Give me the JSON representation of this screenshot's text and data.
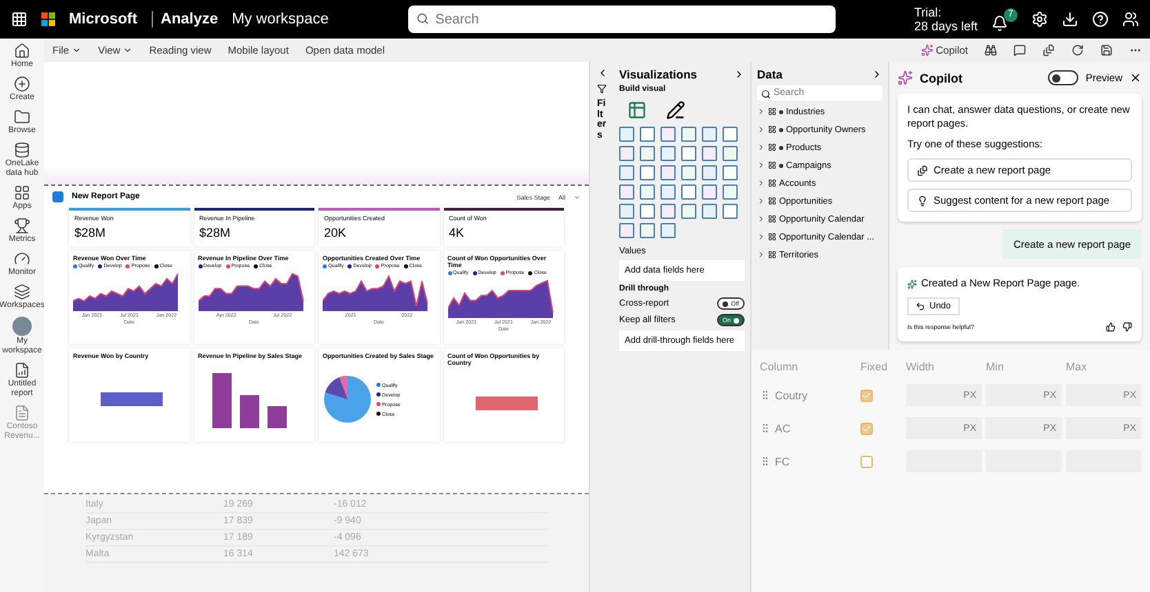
{
  "topbar": {
    "brand": "Microsoft",
    "app": "Analyze",
    "workspace": "My workspace",
    "search": {
      "placeholder": "Search"
    },
    "trial": [
      "Trial:",
      "28 days left"
    ],
    "notification_count": "7"
  },
  "nav": [
    {
      "label": "Home",
      "disabled": false
    },
    {
      "label": "Create",
      "disabled": false
    },
    {
      "label": "Browse",
      "disabled": false
    },
    {
      "label": "OneLake data hub",
      "disabled": false
    },
    {
      "label": "Apps",
      "disabled": false
    },
    {
      "label": "Metrics",
      "disabled": false
    },
    {
      "label": "Monitor",
      "disabled": false
    },
    {
      "label": "Workspaces",
      "disabled": false
    },
    {
      "label": "My workspace",
      "disabled": false
    },
    {
      "label": "Untitled report",
      "disabled": false
    },
    {
      "label": "Contoso Revenu...",
      "disabled": true
    }
  ],
  "toolbar": {
    "menus": [
      {
        "label": "File",
        "dropdown": true
      },
      {
        "label": "View",
        "dropdown": true
      },
      {
        "label": "Reading view",
        "dropdown": false
      },
      {
        "label": "Mobile layout",
        "dropdown": false
      },
      {
        "label": "Open data model",
        "dropdown": false
      }
    ],
    "copilot": "Copilot"
  },
  "report": {
    "title": "New Report Page",
    "slicer": {
      "label": "Sales Stage",
      "value": "All"
    },
    "kpis": [
      {
        "label": "Revenue Won",
        "value": "$28M",
        "color": "#3aa0d8"
      },
      {
        "label": "Revenue In Pipeline",
        "value": "$28M",
        "color": "#1b2a6b"
      },
      {
        "label": "Opportunities Created",
        "value": "20K",
        "color": "#b45fb0"
      },
      {
        "label": "Count of Won",
        "value": "4K",
        "color": "#4a1a4a"
      }
    ],
    "trend_charts": [
      {
        "title": "Revenue Won Over Time",
        "legend": [
          "Qualify",
          "Develop",
          "Propose",
          "Close"
        ],
        "axis": [
          "Jan 2021",
          "Jul 2021",
          "Jan 2022"
        ],
        "xlabel": "Date"
      },
      {
        "title": "Revenue In Pipeline Over Time",
        "legend": [
          "Develop",
          "Propose",
          "Close"
        ],
        "axis": [
          "Apr 2022",
          "Jul 2022"
        ],
        "xlabel": "Date"
      },
      {
        "title": "Opportunities Created Over Time",
        "legend": [
          "Qualify",
          "Develop",
          "Propose",
          "Close"
        ],
        "axis": [
          "2021",
          "2022"
        ],
        "xlabel": "Date"
      },
      {
        "title": "Count of Won Opportunities Over Time",
        "legend": [
          "Qualify",
          "Develop",
          "Propose",
          "Close"
        ],
        "axis": [
          "Jan 2021",
          "Jul 2021",
          "Jan 2022"
        ],
        "xlabel": "Date"
      }
    ],
    "bottom_charts": [
      {
        "title": "Revenue Won by Country",
        "kind": "hbar",
        "color": "#5b5fc7"
      },
      {
        "title": "Revenue In Pipeline by Sales Stage",
        "kind": "vbar",
        "color": "#8e3d9a"
      },
      {
        "title": "Opportunities Created by Sales Stage",
        "kind": "pie",
        "legend": [
          "Qualify",
          "Develop",
          "Propose",
          "Close"
        ]
      },
      {
        "title": "Count of Won Opportunities by Country",
        "kind": "hbar",
        "color": "#e06670"
      }
    ]
  },
  "country_table": [
    [
      "Italy",
      "19 269",
      "-16 012"
    ],
    [
      "Japan",
      "17 839",
      "-9 940"
    ],
    [
      "Kyrgyzstan",
      "17 189",
      "-4 096"
    ],
    [
      "Malta",
      "16 314",
      "142 673"
    ]
  ],
  "filters": {
    "label": "Filters"
  },
  "visualizations": {
    "title": "Visualizations",
    "subtitle": "Build visual",
    "values_label": "Values",
    "values_placeholder": "Add data fields here",
    "drill_title": "Drill through",
    "toggles": [
      {
        "label": "Cross-report",
        "on": false,
        "text": "Off"
      },
      {
        "label": "Keep all filters",
        "on": true,
        "text": "On"
      }
    ],
    "drill_placeholder": "Add drill-through fields here"
  },
  "data": {
    "title": "Data",
    "search": {
      "placeholder": "Search"
    },
    "items": [
      {
        "label": "Industries",
        "starred": true
      },
      {
        "label": "Opportunity Owners",
        "starred": true
      },
      {
        "label": "Products",
        "starred": true
      },
      {
        "label": "Campaigns",
        "starred": true
      },
      {
        "label": "Accounts",
        "starred": false
      },
      {
        "label": "Opportunities",
        "starred": false
      },
      {
        "label": "Opportunity Calendar",
        "starred": false
      },
      {
        "label": "Opportunity Calendar ...",
        "starred": false
      },
      {
        "label": "Territories",
        "starred": false
      }
    ]
  },
  "copilot": {
    "title": "Copilot",
    "preview_on": false,
    "preview_label": "Preview",
    "intro": "I can chat, answer data questions, or create new report pages.",
    "suggest_title": "Try one of these suggestions:",
    "suggestions": [
      {
        "label": "Create a new report page",
        "kind": "page"
      },
      {
        "label": "Suggest content for a new report page",
        "kind": "idea"
      }
    ],
    "user_message": "Create a new report page",
    "response": "Created a New Report Page page.",
    "undo": "Undo",
    "feedback": "Is this response helpful?"
  },
  "column_table": {
    "columns": [
      "Column",
      "Fixed",
      "Width",
      "Min",
      "Max"
    ],
    "rows": [
      {
        "name": "Coutry",
        "fixed": true,
        "width": "PX",
        "min": "PX",
        "max": "PX"
      },
      {
        "name": "AC",
        "fixed": true,
        "width": "PX",
        "min": "PX",
        "max": "PX"
      },
      {
        "name": "FC",
        "fixed": false
      }
    ]
  }
}
